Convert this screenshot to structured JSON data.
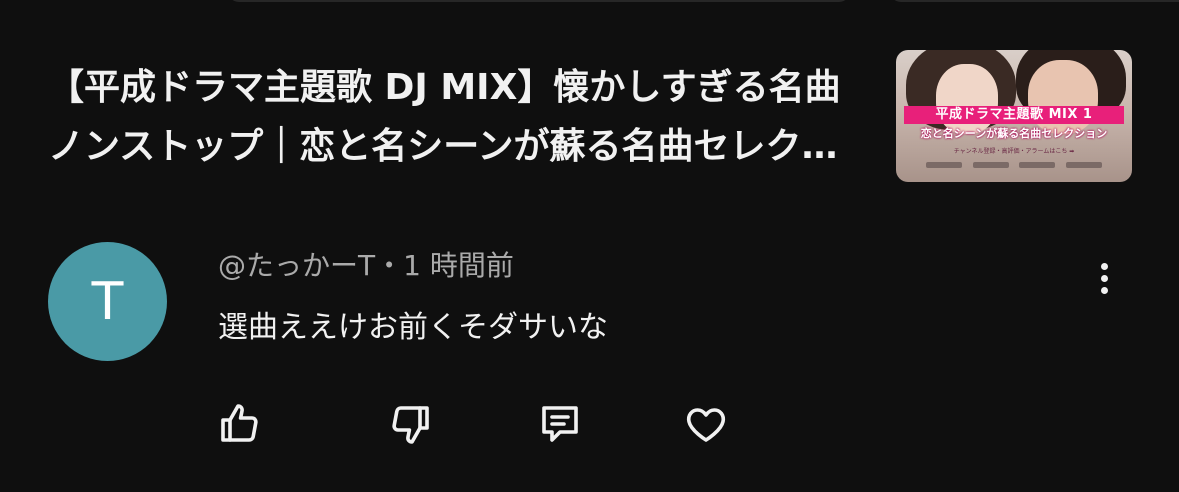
{
  "video": {
    "title": "【平成ドラマ主題歌 DJ MIX】懐かしすぎる名曲ノンストップ｜恋と名シーンが蘇る名曲セレクション",
    "thumbnail": {
      "banner": "平成ドラマ主題歌 MIX 1",
      "subtitle": "恋と名シーンが蘇る名曲セレクション",
      "fine_print": "チャンネル登録・高評価・アラームはこち ➡"
    }
  },
  "comment": {
    "avatar_letter": "T",
    "author": "@たっかーT",
    "separator": "・",
    "time": "1 時間前",
    "text": "選曲ええけお前くそダサいな"
  },
  "icons": {
    "like": "thumbs-up-icon",
    "dislike": "thumbs-down-icon",
    "reply": "reply-comment-icon",
    "heart": "heart-icon",
    "more": "more-vertical-icon"
  },
  "colors": {
    "background": "#0f0f0f",
    "avatar": "#4a9aa6",
    "thumbnail_banner": "#e8207a"
  }
}
